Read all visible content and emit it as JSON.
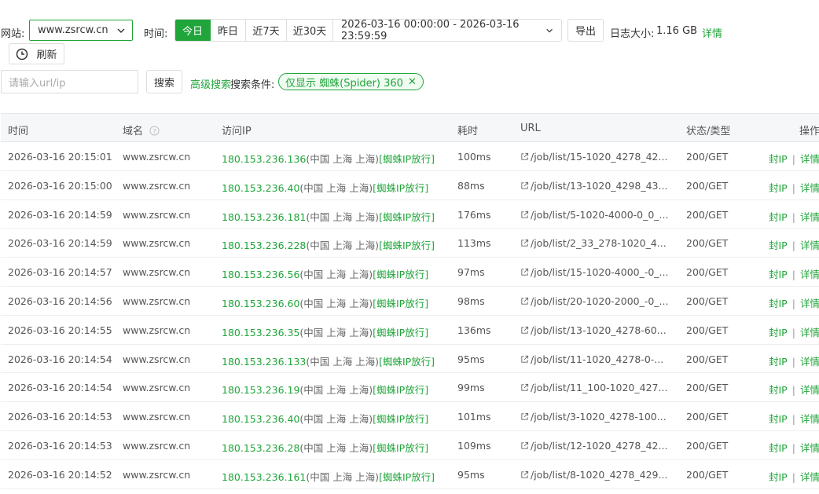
{
  "toolbar": {
    "site_label": "网站:",
    "site_value": "www.zsrcw.cn",
    "time_label": "时间:",
    "time_buttons": [
      "今日",
      "昨日",
      "近7天",
      "近30天"
    ],
    "active_time": "今日",
    "date_range": "2026-03-16 00:00:00 - 2026-03-16 23:59:59",
    "export_label": "导出",
    "log_size_label": "日志大小:",
    "log_size_value": "1.16 GB",
    "detail_link": "详情",
    "refresh_label": "刷新"
  },
  "search": {
    "placeholder": "请输入url/ip",
    "button_label": "搜索",
    "advanced_link": "高级搜索",
    "conditions_label": "搜索条件:",
    "filter_tag": "仅显示 蜘蛛(Spider) 360"
  },
  "table": {
    "columns": [
      "时间",
      "域名",
      "访问IP",
      "耗时",
      "URL",
      "状态/类型",
      "操作"
    ],
    "rows": [
      {
        "time": "2026-03-16 20:15:01",
        "domain": "www.zsrcw.cn",
        "ip": "180.153.236.136",
        "geo": "(中国 上海 上海)",
        "ip_tag": "[蜘蛛IP放行]",
        "cost": "100ms",
        "url": "/job/list/15-1020_4278_42...",
        "status": "200/GET"
      },
      {
        "time": "2026-03-16 20:15:00",
        "domain": "www.zsrcw.cn",
        "ip": "180.153.236.40",
        "geo": "(中国 上海 上海)",
        "ip_tag": "[蜘蛛IP放行]",
        "cost": "88ms",
        "url": "/job/list/13-1020_4298_43...",
        "status": "200/GET"
      },
      {
        "time": "2026-03-16 20:14:59",
        "domain": "www.zsrcw.cn",
        "ip": "180.153.236.181",
        "geo": "(中国 上海 上海)",
        "ip_tag": "[蜘蛛IP放行]",
        "cost": "176ms",
        "url": "/job/list/5-1020-4000-0_0_...",
        "status": "200/GET"
      },
      {
        "time": "2026-03-16 20:14:59",
        "domain": "www.zsrcw.cn",
        "ip": "180.153.236.228",
        "geo": "(中国 上海 上海)",
        "ip_tag": "[蜘蛛IP放行]",
        "cost": "113ms",
        "url": "/job/list/2_33_278-1020_4...",
        "status": "200/GET"
      },
      {
        "time": "2026-03-16 20:14:57",
        "domain": "www.zsrcw.cn",
        "ip": "180.153.236.56",
        "geo": "(中国 上海 上海)",
        "ip_tag": "[蜘蛛IP放行]",
        "cost": "97ms",
        "url": "/job/list/15-1020-4000_-0_...",
        "status": "200/GET"
      },
      {
        "time": "2026-03-16 20:14:56",
        "domain": "www.zsrcw.cn",
        "ip": "180.153.236.60",
        "geo": "(中国 上海 上海)",
        "ip_tag": "[蜘蛛IP放行]",
        "cost": "98ms",
        "url": "/job/list/20-1020-2000_-0_...",
        "status": "200/GET"
      },
      {
        "time": "2026-03-16 20:14:55",
        "domain": "www.zsrcw.cn",
        "ip": "180.153.236.35",
        "geo": "(中国 上海 上海)",
        "ip_tag": "[蜘蛛IP放行]",
        "cost": "136ms",
        "url": "/job/list/13-1020_4278-60...",
        "status": "200/GET"
      },
      {
        "time": "2026-03-16 20:14:54",
        "domain": "www.zsrcw.cn",
        "ip": "180.153.236.133",
        "geo": "(中国 上海 上海)",
        "ip_tag": "[蜘蛛IP放行]",
        "cost": "95ms",
        "url": "/job/list/11-1020_4278-0-...",
        "status": "200/GET"
      },
      {
        "time": "2026-03-16 20:14:54",
        "domain": "www.zsrcw.cn",
        "ip": "180.153.236.19",
        "geo": "(中国 上海 上海)",
        "ip_tag": "[蜘蛛IP放行]",
        "cost": "99ms",
        "url": "/job/list/11_100-1020_427...",
        "status": "200/GET"
      },
      {
        "time": "2026-03-16 20:14:53",
        "domain": "www.zsrcw.cn",
        "ip": "180.153.236.40",
        "geo": "(中国 上海 上海)",
        "ip_tag": "[蜘蛛IP放行]",
        "cost": "101ms",
        "url": "/job/list/3-1020_4278-100...",
        "status": "200/GET"
      },
      {
        "time": "2026-03-16 20:14:53",
        "domain": "www.zsrcw.cn",
        "ip": "180.153.236.28",
        "geo": "(中国 上海 上海)",
        "ip_tag": "[蜘蛛IP放行]",
        "cost": "109ms",
        "url": "/job/list/12-1020_4278_42...",
        "status": "200/GET"
      },
      {
        "time": "2026-03-16 20:14:52",
        "domain": "www.zsrcw.cn",
        "ip": "180.153.236.161",
        "geo": "(中国 上海 上海)",
        "ip_tag": "[蜘蛛IP放行]",
        "cost": "95ms",
        "url": "/job/list/8-1020_4278_429...",
        "status": "200/GET"
      }
    ],
    "action_block": "封IP",
    "action_sep": "|",
    "action_detail": "详情"
  },
  "colors": {
    "accent": "#20a53a",
    "header_bg": "#f5f7f9"
  }
}
